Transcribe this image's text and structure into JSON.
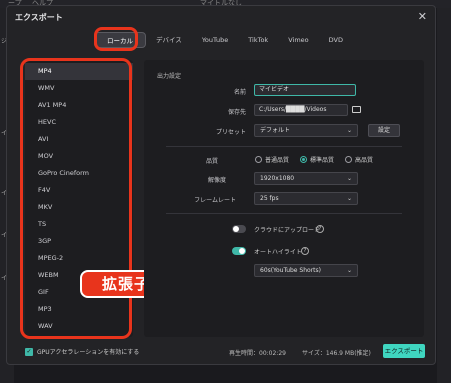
{
  "background": {
    "topbar_items": [
      "ープ",
      "ヘルプ",
      "マイトルなし"
    ],
    "left_tags": [
      "ジェ",
      "イル",
      "イル",
      "イル",
      "イル"
    ]
  },
  "dialog": {
    "title": "エクスポート",
    "close_icon": "close-icon"
  },
  "tabs": [
    {
      "label": "ローカル",
      "active": true
    },
    {
      "label": "デバイス",
      "active": false
    },
    {
      "label": "YouTube",
      "active": false
    },
    {
      "label": "TikTok",
      "active": false
    },
    {
      "label": "Vimeo",
      "active": false
    },
    {
      "label": "DVD",
      "active": false
    }
  ],
  "formats": [
    "MP4",
    "WMV",
    "AV1 MP4",
    "HEVC",
    "AVI",
    "MOV",
    "GoPro Cineform",
    "F4V",
    "MKV",
    "TS",
    "3GP",
    "MPEG-2",
    "WEBM",
    "GIF",
    "MP3",
    "WAV"
  ],
  "selected_format": "MP4",
  "callout": "拡張子を選ぶ",
  "settings": {
    "section_title": "出力設定",
    "name_label": "名前",
    "name_value": "マイビデオ",
    "path_label": "保存先",
    "path_value": "C:/Users/████/Videos",
    "preset_label": "プリセット",
    "preset_value": "デフォルト",
    "preset_button": "設定",
    "quality_label": "品質",
    "quality_options": [
      {
        "label": "普通品質",
        "on": false
      },
      {
        "label": "標準品質",
        "on": true
      },
      {
        "label": "高品質",
        "on": false
      }
    ],
    "resolution_label": "解像度",
    "resolution_value": "1920x1080",
    "framerate_label": "フレームレート",
    "framerate_value": "25 fps",
    "cloud_label": "クラウドにアップロード",
    "cloud_on": false,
    "highlight_label": "オートハイライト",
    "highlight_on": true,
    "highlight_value": "60s(YouTube Shorts)"
  },
  "footer": {
    "gpu_label": "GPUアクセラレーションを有効にする",
    "duration": "再生時間：00:02:29",
    "size": "サイズ：146.9 MB(推定)",
    "export_label": "エクスポート"
  },
  "colors": {
    "accent": "#3fd6c0",
    "highlight_red": "#e8341c"
  }
}
